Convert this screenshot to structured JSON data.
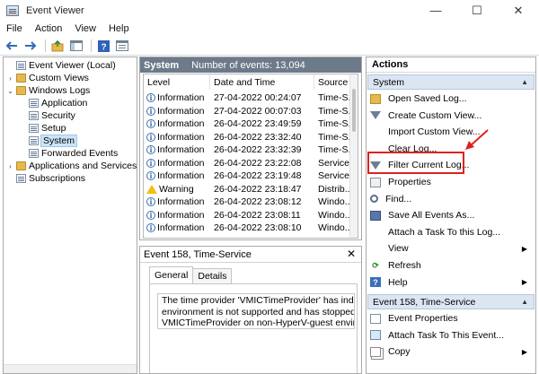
{
  "window": {
    "title": "Event Viewer",
    "controls": {
      "minimize": "—",
      "maximize": "☐",
      "close": "✕"
    }
  },
  "menu": [
    "File",
    "Action",
    "View",
    "Help"
  ],
  "toolbar": {
    "icons": [
      "back-arrow-icon",
      "forward-arrow-icon",
      "up-folder-icon",
      "show-hide-tree-icon",
      "help-icon",
      "properties-icon"
    ]
  },
  "tree": {
    "items": [
      {
        "label": "Event Viewer (Local)",
        "expander": "",
        "icon": "event-viewer-icon"
      },
      {
        "label": "Custom Views",
        "expander": "›",
        "icon": "folder-icon"
      },
      {
        "label": "Windows Logs",
        "expander": "⌄",
        "icon": "folder-icon"
      },
      {
        "label": "Application",
        "expander": "",
        "icon": "log-icon"
      },
      {
        "label": "Security",
        "expander": "",
        "icon": "log-icon"
      },
      {
        "label": "Setup",
        "expander": "",
        "icon": "log-icon"
      },
      {
        "label": "System",
        "expander": "",
        "icon": "log-icon",
        "selected": true
      },
      {
        "label": "Forwarded Events",
        "expander": "",
        "icon": "log-icon"
      },
      {
        "label": "Applications and Services Lo",
        "expander": "›",
        "icon": "folder-icon"
      },
      {
        "label": "Subscriptions",
        "expander": "",
        "icon": "log-icon"
      }
    ]
  },
  "events_pane": {
    "title": "System",
    "count_text": "Number of events: 13,094",
    "columns": [
      "Level",
      "Date and Time",
      "Source"
    ],
    "rows": [
      {
        "level": "Information",
        "datetime": "27-04-2022 00:24:07",
        "source": "Time-S..."
      },
      {
        "level": "Information",
        "datetime": "27-04-2022 00:07:03",
        "source": "Time-S..."
      },
      {
        "level": "Information",
        "datetime": "26-04-2022 23:49:59",
        "source": "Time-S..."
      },
      {
        "level": "Information",
        "datetime": "26-04-2022 23:32:40",
        "source": "Time-S..."
      },
      {
        "level": "Information",
        "datetime": "26-04-2022 23:32:39",
        "source": "Time-S..."
      },
      {
        "level": "Information",
        "datetime": "26-04-2022 23:22:08",
        "source": "Service..."
      },
      {
        "level": "Information",
        "datetime": "26-04-2022 23:19:48",
        "source": "Service..."
      },
      {
        "level": "Warning",
        "datetime": "26-04-2022 23:18:47",
        "source": "Distrib..."
      },
      {
        "level": "Information",
        "datetime": "26-04-2022 23:08:12",
        "source": "Windo..."
      },
      {
        "level": "Information",
        "datetime": "26-04-2022 23:08:11",
        "source": "Windo..."
      },
      {
        "level": "Information",
        "datetime": "26-04-2022 23:08:10",
        "source": "Windo..."
      }
    ]
  },
  "detail_pane": {
    "title": "Event 158, Time-Service",
    "close": "✕",
    "tabs": [
      "General",
      "Details"
    ],
    "description_lines": [
      "The time provider 'VMICTimeProvider' has indicate",
      "environment is not supported and has stopped. Th",
      "VMICTimeProvider on non-HyperV-guest environn"
    ]
  },
  "actions": {
    "title": "Actions",
    "system_section": "System",
    "system_items": [
      {
        "label": "Open Saved Log...",
        "icon": "open-folder-icon",
        "submenu": false
      },
      {
        "label": "Create Custom View...",
        "icon": "filter-icon",
        "submenu": false
      },
      {
        "label": "Import Custom View...",
        "icon": "",
        "submenu": false
      },
      {
        "label": "Clear Log...",
        "icon": "",
        "submenu": false
      },
      {
        "label": "Filter Current Log...",
        "icon": "filter-icon",
        "submenu": false
      },
      {
        "label": "Properties",
        "icon": "properties-icon",
        "submenu": false
      },
      {
        "label": "Find...",
        "icon": "find-icon",
        "submenu": false
      },
      {
        "label": "Save All Events As...",
        "icon": "save-icon",
        "submenu": false
      },
      {
        "label": "Attach a Task To this Log...",
        "icon": "",
        "submenu": false
      },
      {
        "label": "View",
        "icon": "",
        "submenu": true
      },
      {
        "label": "Refresh",
        "icon": "refresh-icon",
        "submenu": false
      },
      {
        "label": "Help",
        "icon": "help-icon",
        "submenu": true
      }
    ],
    "event_section": "Event 158, Time-Service",
    "event_items": [
      {
        "label": "Event Properties",
        "icon": "event-properties-icon",
        "submenu": false
      },
      {
        "label": "Attach Task To This Event...",
        "icon": "attach-task-icon",
        "submenu": false
      },
      {
        "label": "Copy",
        "icon": "copy-icon",
        "submenu": true
      }
    ]
  },
  "colors": {
    "pane_header": "#6c7a8a",
    "section_bg": "#dce6f2",
    "highlight": "#e02020",
    "selection": "#cce4f7"
  }
}
